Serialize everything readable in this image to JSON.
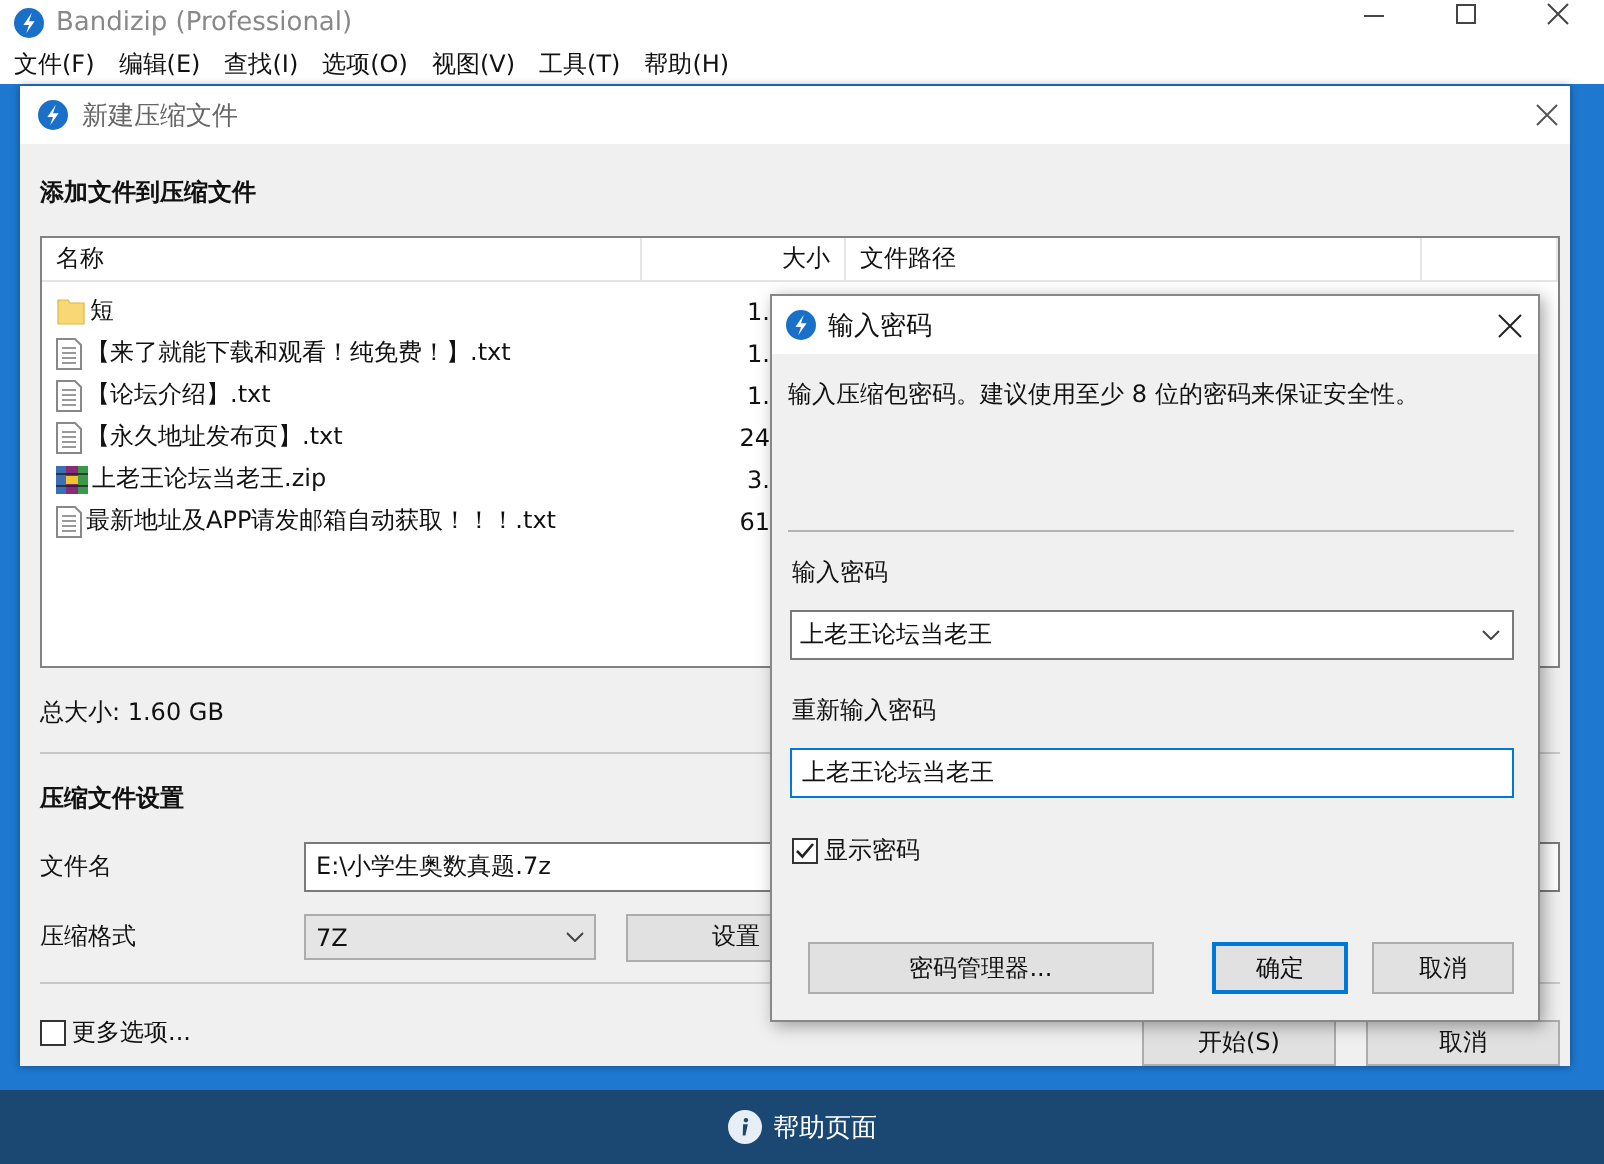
{
  "window": {
    "title": "Bandizip (Professional)"
  },
  "menu": [
    "文件(F)",
    "编辑(E)",
    "查找(I)",
    "选项(O)",
    "视图(V)",
    "工具(T)",
    "帮助(H)"
  ],
  "new_archive_dialog": {
    "title": "新建压缩文件",
    "heading": "添加文件到压缩文件",
    "file_list": {
      "columns": [
        "名称",
        "大小",
        "文件路径"
      ],
      "rows": [
        {
          "kind": "folder",
          "name": "短",
          "size": "1."
        },
        {
          "kind": "text",
          "name": "【来了就能下载和观看！纯免费！】.txt",
          "size": "1."
        },
        {
          "kind": "text",
          "name": "【论坛介绍】.txt",
          "size": "1."
        },
        {
          "kind": "text",
          "name": "【永久地址发布页】.txt",
          "size": "24"
        },
        {
          "kind": "archive",
          "name": "上老王论坛当老王.zip",
          "size": "3."
        },
        {
          "kind": "text",
          "name": "最新地址及APP请发邮箱自动获取！！！.txt",
          "size": "61"
        }
      ]
    },
    "total_size": "总大小: 1.60 GB",
    "settings_heading": "压缩文件设置",
    "filename_label": "文件名",
    "filename": "E:\\小学生奥数真题.7z",
    "format_label": "压缩格式",
    "format": "7Z",
    "password_button": "设置",
    "more_options": {
      "label": "更多选项...",
      "checked": false
    },
    "buttons": [
      "开始(S)",
      "取消"
    ]
  },
  "password_dialog": {
    "title": "输入密码",
    "description": "输入压缩包密码。建议使用至少 8 位的密码来保证安全性。",
    "password_label": "输入密码",
    "password": "上老王论坛当老王",
    "confirm_label": "重新输入密码",
    "confirm": "上老王论坛当老王",
    "show_password": {
      "label": "显示密码",
      "checked": true
    },
    "buttons": [
      {
        "label": "密码管理器...",
        "default": false
      },
      {
        "label": "确定",
        "default": true
      },
      {
        "label": "取消",
        "default": false
      }
    ]
  },
  "help_bar": {
    "label": "帮助页面"
  }
}
